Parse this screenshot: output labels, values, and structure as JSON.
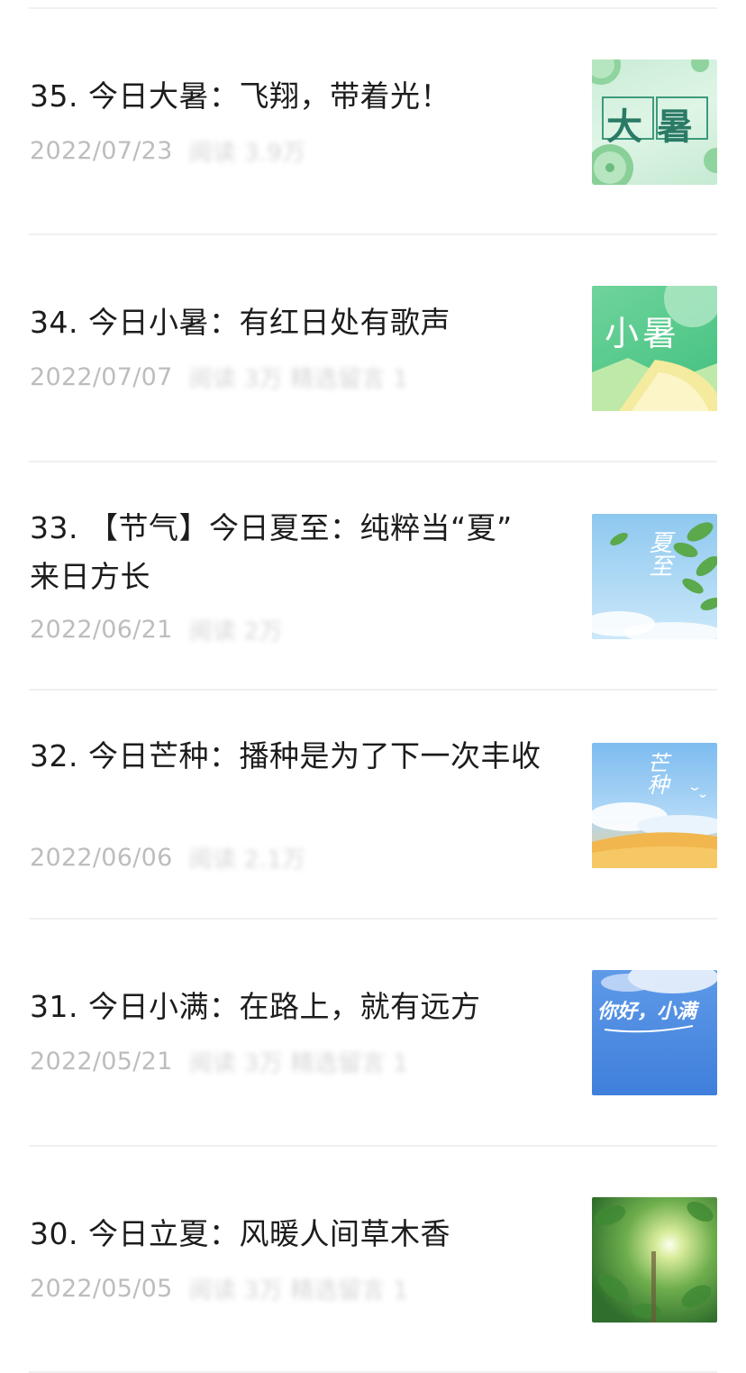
{
  "articles": [
    {
      "title": "35. 今日大暑：飞翔，带着光！",
      "date": "2022/07/23",
      "hidden": "阅读 3.9万",
      "thumb_text": "大暑",
      "thumb_name": "thumbnail-dashu"
    },
    {
      "title": "34. 今日小暑：有红日处有歌声",
      "date": "2022/07/07",
      "hidden": "阅读 3万  精选留言 1",
      "thumb_text": "小暑",
      "thumb_name": "thumbnail-xiaoshu"
    },
    {
      "title": "33. 【节气】今日夏至：纯粹当“夏” 来日方长",
      "date": "2022/06/21",
      "hidden": "阅读 2万",
      "thumb_text": "夏至",
      "thumb_name": "thumbnail-xiazhi"
    },
    {
      "title": "32. 今日芒种：播种是为了下一次丰收",
      "date": "2022/06/06",
      "hidden": "阅读 2.1万",
      "thumb_text": "芒种",
      "thumb_name": "thumbnail-mangzhong"
    },
    {
      "title": "31. 今日小满：在路上，就有远方",
      "date": "2022/05/21",
      "hidden": "阅读 3万  精选留言 1",
      "thumb_text": "你好，小满",
      "thumb_name": "thumbnail-xiaoman"
    },
    {
      "title": "30. 今日立夏：风暖人间草木香",
      "date": "2022/05/05",
      "hidden": "阅读 3万  精选留言 1",
      "thumb_text": "",
      "thumb_name": "thumbnail-lixia"
    }
  ]
}
